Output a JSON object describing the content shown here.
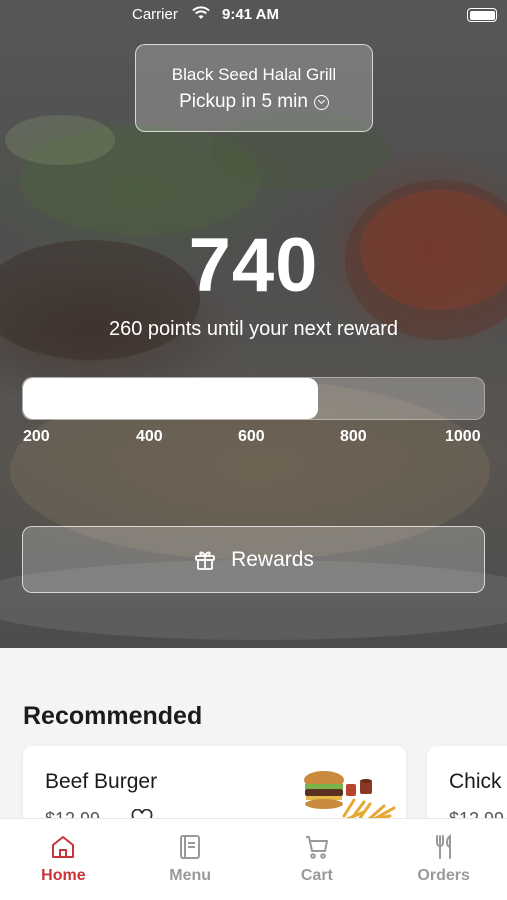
{
  "status_bar": {
    "carrier": "Carrier",
    "time": "9:41 AM"
  },
  "store": {
    "name": "Black Seed Halal Grill",
    "pickup": "Pickup in 5 min"
  },
  "points": {
    "value": "740",
    "subtitle": "260 points until your next reward",
    "progress": 0.64,
    "ticks": [
      "200",
      "400",
      "600",
      "800",
      "1000"
    ]
  },
  "rewards_button": {
    "label": "Rewards"
  },
  "recommended": {
    "title": "Recommended",
    "items": [
      {
        "name": "Beef Burger",
        "price": "$12.99"
      },
      {
        "name": "Chick",
        "price": "$12.99"
      }
    ]
  },
  "tabs": [
    {
      "label": "Home",
      "icon": "home-icon",
      "active": true
    },
    {
      "label": "Menu",
      "icon": "menu-book-icon",
      "active": false
    },
    {
      "label": "Cart",
      "icon": "cart-icon",
      "active": false
    },
    {
      "label": "Orders",
      "icon": "fork-knife-icon",
      "active": false
    }
  ],
  "colors": {
    "accent": "#c8343a",
    "inactive_tab": "#9a9a9a"
  }
}
